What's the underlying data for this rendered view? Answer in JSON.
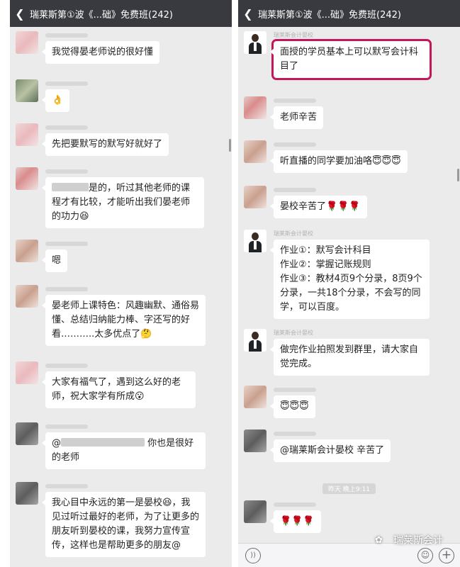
{
  "chat_title": "瑞莱斯第①波《...础》免费班(242)",
  "left": {
    "messages": [
      {
        "text": "我觉得晏老师说的很好懂"
      },
      {
        "text": "👌"
      },
      {
        "text": "先把要默写的默写好就好了"
      },
      {
        "text": "是的，听过其他老师的课程才有比较，才能听出我们晏老师的功力😆"
      },
      {
        "text": "嗯"
      },
      {
        "text": "晏老师上课特色：风趣幽默、通俗易懂、总结归纳能力棒、字还写的好看………..太多优点了🤔"
      },
      {
        "text": "大家有福气了，遇到这么好的老师，祝大家学有所成😮"
      },
      {
        "text": "你也是很好的老师",
        "prefix": "@"
      },
      {
        "text": "我心目中永远的第一是晏校😆，我见过听过最好的老师，为了让更多的朋友听到晏校的课，我努力宣传宣传，这样也是帮助更多的朋友@"
      }
    ]
  },
  "right": {
    "messages": [
      {
        "name": "瑞莱斯会计晏校",
        "text": "面授的学员基本上可以默写会计科目了"
      },
      {
        "text": "老师辛苦"
      },
      {
        "text": "听直播的同学要加油咯😇😇😇"
      },
      {
        "text": "晏校辛苦了🌹🌹🌹"
      },
      {
        "name": "瑞莱斯会计晏校",
        "lines": [
          "作业①：默写会计科目",
          "作业②：掌握记账规则",
          "作业③：教材4页9个分录，8页9个分录，一共18个分录，不会写的同学，可以百度。"
        ]
      },
      {
        "name": "瑞莱斯会计晏校",
        "text": "做完作业拍照发到群里，请大家自觉完成。"
      },
      {
        "text": "😇😇😇"
      },
      {
        "text": "@瑞莱斯会计晏校  辛苦了"
      },
      {
        "text": "🌹🌹🌹"
      }
    ],
    "timestamp": "昨天 晚上9:11"
  },
  "watermark": "瑞莱斯会计",
  "icons": {
    "back": "back-arrow-icon",
    "voice": "voice-icon",
    "emoji": "emoji-icon",
    "plus": "plus-icon"
  },
  "colors": {
    "topbar": "#393a3f",
    "chat_bg": "#ebebeb",
    "highlight": "#c2185b"
  }
}
